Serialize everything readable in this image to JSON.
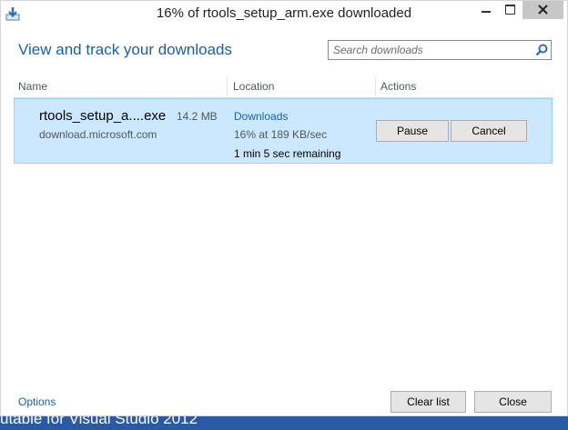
{
  "window": {
    "title": "16% of rtools_setup_arm.exe downloaded"
  },
  "header": {
    "heading": "View and track your downloads",
    "search_placeholder": "Search downloads"
  },
  "columns": {
    "name": "Name",
    "location": "Location",
    "actions": "Actions"
  },
  "download": {
    "file_name": "rtools_setup_a....exe",
    "size": "14.2 MB",
    "source": "download.microsoft.com",
    "location": "Downloads",
    "progress": "16% at 189 KB/sec",
    "remaining": "1 min 5 sec remaining",
    "pause_label": "Pause",
    "cancel_label": "Cancel"
  },
  "footer": {
    "options_label": "Options",
    "clear_list_label": "Clear list",
    "close_label": "Close"
  },
  "taskbar": {
    "partial_text": "utable for Visual Studio 2012"
  },
  "colors": {
    "link": "#1a5fa8",
    "row_selected_bg": "#cce8ff",
    "row_selected_border": "#99d1ff",
    "taskbar": "#2a5aa5"
  },
  "icons": {
    "app": "download-app-icon",
    "search": "search-icon",
    "minimize": "minimize-icon",
    "maximize": "maximize-icon",
    "close": "close-icon"
  }
}
